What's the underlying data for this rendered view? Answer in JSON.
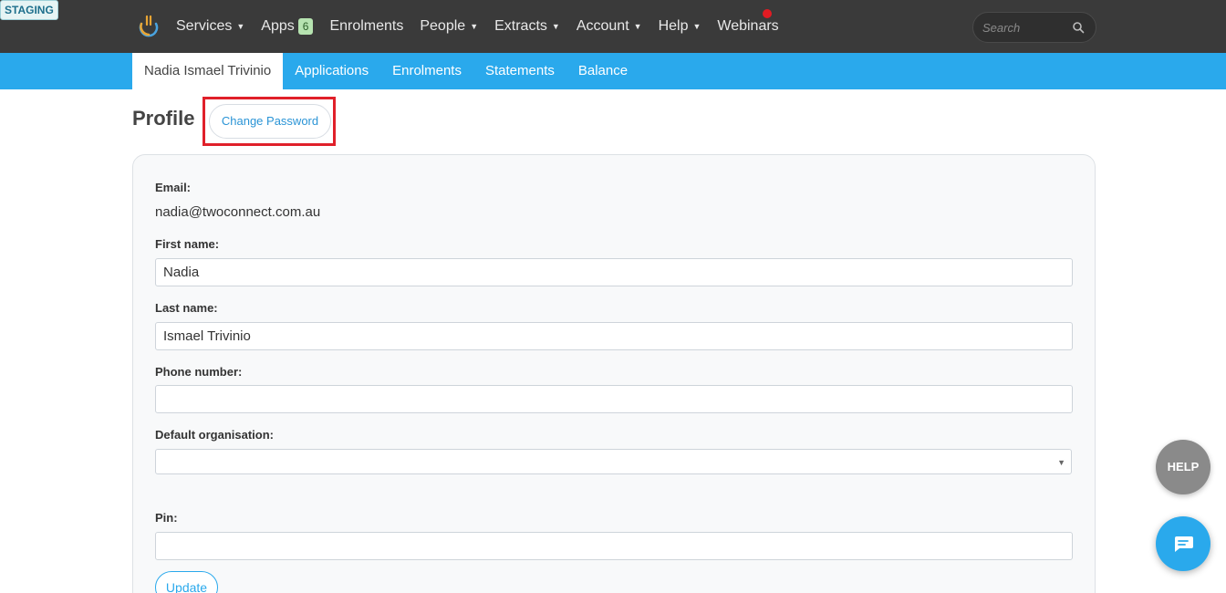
{
  "env_badge": "STAGING",
  "nav": {
    "items": [
      {
        "label": "Services",
        "caret": true
      },
      {
        "label": "Apps",
        "badge": "6"
      },
      {
        "label": "Enrolments"
      },
      {
        "label": "People",
        "caret": true
      },
      {
        "label": "Extracts",
        "caret": true
      },
      {
        "label": "Account",
        "caret": true
      },
      {
        "label": "Help",
        "caret": true
      },
      {
        "label": "Webinars"
      }
    ],
    "search_placeholder": "Search"
  },
  "subnav": {
    "items": [
      {
        "label": "Nadia Ismael Trivinio",
        "active": true
      },
      {
        "label": "Applications"
      },
      {
        "label": "Enrolments"
      },
      {
        "label": "Statements"
      },
      {
        "label": "Balance"
      }
    ]
  },
  "profile": {
    "title": "Profile",
    "change_password_label": "Change Password",
    "email_label": "Email:",
    "email_value": "nadia@twoconnect.com.au",
    "first_name_label": "First name:",
    "first_name_value": "Nadia",
    "last_name_label": "Last name:",
    "last_name_value": "Ismael Trivinio",
    "phone_label": "Phone number:",
    "phone_value": "",
    "default_org_label": "Default organisation:",
    "default_org_value": "",
    "pin_label": "Pin:",
    "pin_value": "",
    "update_label": "Update"
  },
  "widgets": {
    "help_label": "HELP"
  },
  "colors": {
    "topbar": "#3a3a3a",
    "subnav": "#2aa9ec",
    "highlight": "#e0202a",
    "notification": "#e21b23"
  }
}
